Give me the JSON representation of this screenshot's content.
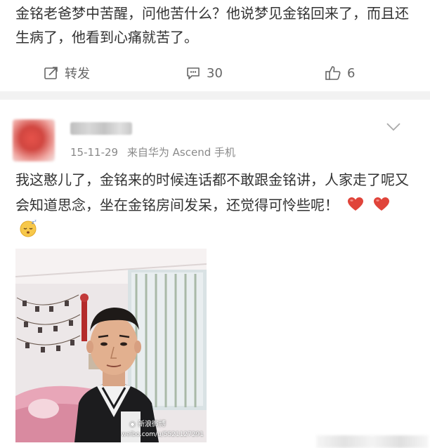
{
  "previous_post": {
    "text": "金铭老爸梦中苦醒，问他苦什么？他说梦见金铭回来了，而且还生病了，他看到心痛就苦了。",
    "actions": {
      "repost_label": "转发",
      "comment_count": "30",
      "like_count": "6"
    }
  },
  "post": {
    "timestamp": "15-11-29",
    "source": "来自华为 Ascend 手机",
    "text": "我这憨儿了，金铭来的时候连话都不敢跟金铭讲，人家走了呢又会知道思念，坐在金铭房间发呆，还觉得可怜些呢！",
    "emojis": [
      "heart",
      "heart",
      "sleepy-face"
    ],
    "photo_watermark": "weibo.com/u/5521127291"
  },
  "colors": {
    "text": "#333333",
    "meta": "#8a8a8a",
    "action": "#666666",
    "separator": "#f2f2f2",
    "heart": "#e0443a"
  }
}
